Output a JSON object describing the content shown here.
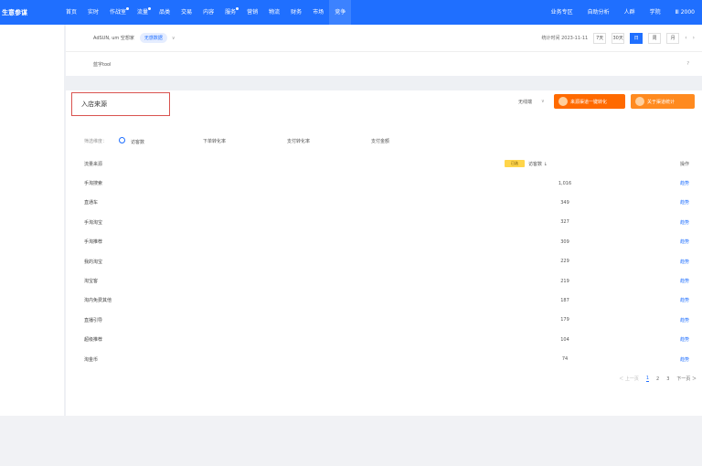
{
  "brand": {
    "title": "生意参谋"
  },
  "nav": {
    "items": [
      {
        "label": "首页",
        "dot": false
      },
      {
        "label": "实时",
        "dot": false
      },
      {
        "label": "作战室",
        "dot": true
      },
      {
        "label": "流量",
        "dot": true
      },
      {
        "label": "品类",
        "dot": false
      },
      {
        "label": "交易",
        "dot": false
      },
      {
        "label": "内容",
        "dot": false
      },
      {
        "label": "服务",
        "dot": true
      },
      {
        "label": "营销",
        "dot": false
      },
      {
        "label": "物流",
        "dot": false
      },
      {
        "label": "财务",
        "dot": false
      },
      {
        "label": "市场",
        "dot": false
      },
      {
        "label": "竞争",
        "dot": false,
        "active": true
      }
    ],
    "right": [
      "业务专区",
      "自助分析",
      "人群",
      "学院",
      "Ⅲ 2000"
    ]
  },
  "shopbar": {
    "name": "AdSUN, um 空想家",
    "badge": "无感数据",
    "caret": "∨",
    "date_range": "统计时间 2023-11-11",
    "ranges": [
      "7天",
      "30天",
      "日",
      "周",
      "月"
    ],
    "active_range": 2,
    "prev": "‹",
    "next": "›"
  },
  "notice": {
    "text": "蓝字tool",
    "help": "?"
  },
  "card": {
    "title": "入店来源",
    "select_label": "无线端",
    "select_caret": "∨",
    "btn_a": "来源渠道一键转化",
    "btn_b": "关于渠道统计"
  },
  "filters": {
    "label": "筛选维度：",
    "options": [
      "访客数",
      "下单转化率",
      "支付转化率",
      "支付金额"
    ]
  },
  "table": {
    "headers": {
      "name": "流量来源",
      "badge": "已选",
      "value": "访客数 ↓",
      "op": "操作"
    },
    "rows": [
      {
        "name": "手淘搜索",
        "value": "1,016",
        "op": "趋势"
      },
      {
        "name": "直通车",
        "value": "349",
        "op": "趋势"
      },
      {
        "name": "手淘淘宝",
        "value": "327",
        "op": "趋势"
      },
      {
        "name": "手淘推荐",
        "value": "309",
        "op": "趋势"
      },
      {
        "name": "我的淘宝",
        "value": "229",
        "op": "趋势"
      },
      {
        "name": "淘宝客",
        "value": "219",
        "op": "趋势"
      },
      {
        "name": "淘内免费其他",
        "value": "187",
        "op": "趋势"
      },
      {
        "name": "直播引导",
        "value": "179",
        "op": "趋势"
      },
      {
        "name": "超级推荐",
        "value": "104",
        "op": "趋势"
      },
      {
        "name": "淘金币",
        "value": "74",
        "op": "趋势"
      }
    ]
  },
  "pager": {
    "prev": "＜ 上一页",
    "pages": [
      "1",
      "2",
      "3"
    ],
    "current": 0,
    "next": "下一页 ＞"
  }
}
